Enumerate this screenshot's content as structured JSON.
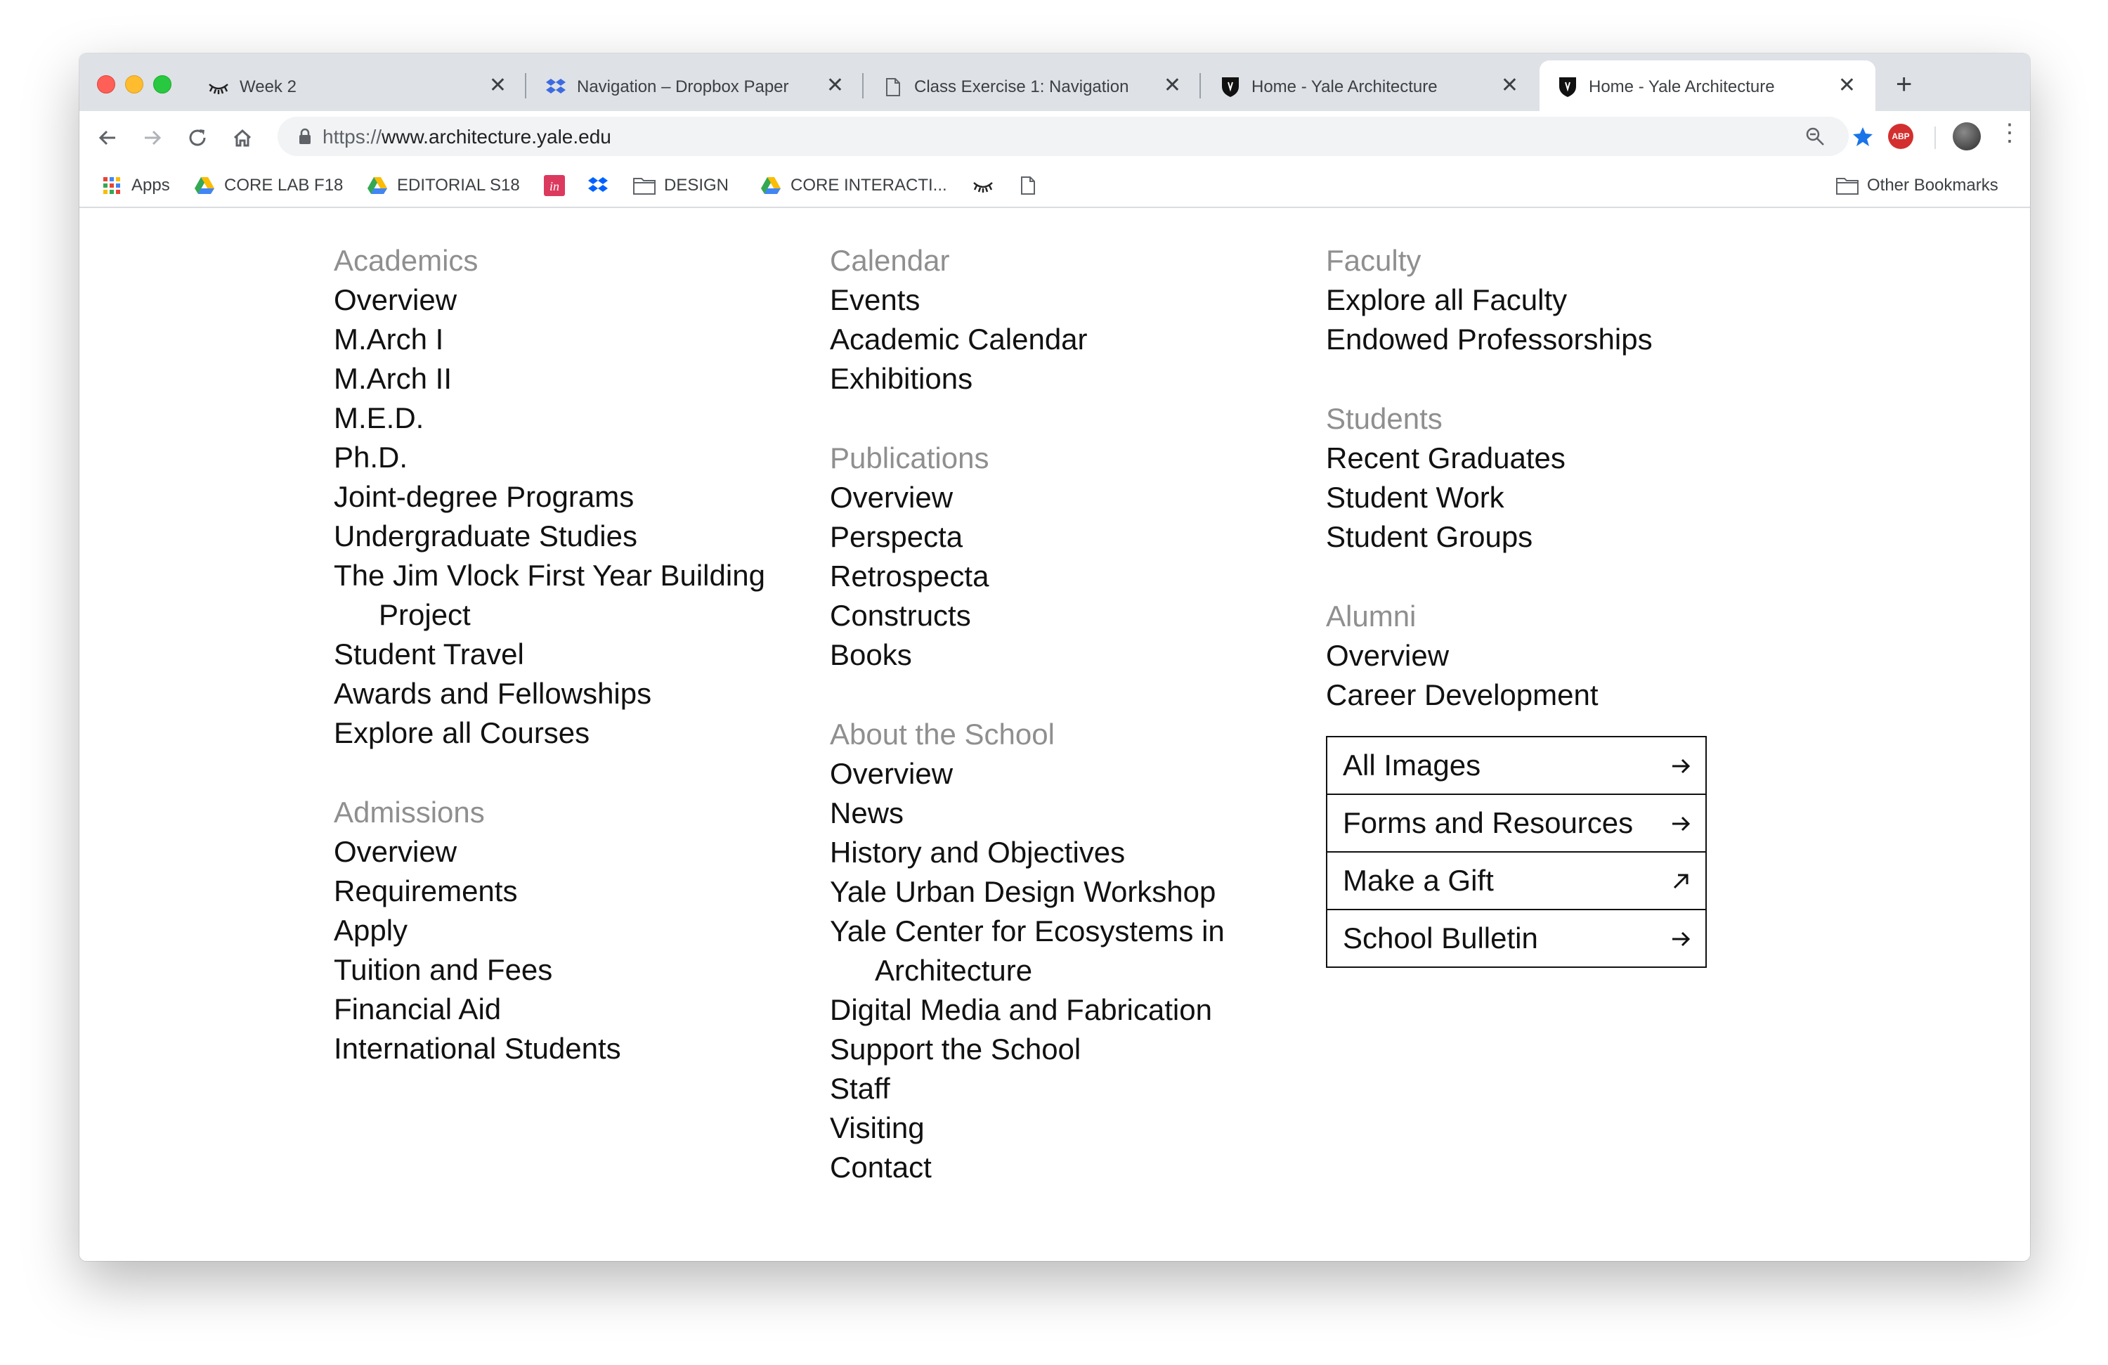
{
  "browser": {
    "tabs": [
      {
        "title": "Week 2",
        "favicon": "eyelash-icon",
        "active": false
      },
      {
        "title": "Navigation – Dropbox Paper",
        "favicon": "dropbox-icon",
        "active": false
      },
      {
        "title": "Class Exercise 1: Navigation",
        "favicon": "document-icon",
        "active": false
      },
      {
        "title": "Home - Yale Architecture",
        "favicon": "yale-shield-icon",
        "active": false
      },
      {
        "title": "Home - Yale Architecture",
        "favicon": "yale-shield-icon",
        "active": true
      }
    ],
    "address": {
      "scheme": "https://",
      "host": "www.architecture.yale.edu"
    },
    "bookmarks": [
      {
        "label": "Apps",
        "icon": "apps-grid-icon"
      },
      {
        "label": "CORE LAB F18",
        "icon": "google-drive-icon"
      },
      {
        "label": "EDITORIAL S18",
        "icon": "google-drive-icon"
      },
      {
        "label": "",
        "icon": "invision-icon"
      },
      {
        "label": "",
        "icon": "dropbox-icon"
      },
      {
        "label": "DESIGN",
        "icon": "folder-icon"
      },
      {
        "label": "CORE INTERACTI...",
        "icon": "google-drive-icon"
      },
      {
        "label": "",
        "icon": "eyelash-icon"
      },
      {
        "label": "",
        "icon": "document-icon"
      }
    ],
    "other_bookmarks": "Other Bookmarks"
  },
  "nav": {
    "academics": {
      "title": "Academics",
      "links": [
        "Overview",
        "M.Arch I",
        "M.Arch II",
        "M.E.D.",
        "Ph.D.",
        "Joint-degree Programs",
        "Undergraduate Studies"
      ],
      "jim_vlock_line1": "The Jim Vlock First Year Building",
      "jim_vlock_line2": "Project",
      "links_after": [
        "Student Travel",
        "Awards and Fellowships",
        "Explore all Courses"
      ]
    },
    "admissions": {
      "title": "Admissions",
      "links": [
        "Overview",
        "Requirements",
        "Apply",
        "Tuition and Fees",
        "Financial Aid",
        "International Students"
      ]
    },
    "calendar": {
      "title": "Calendar",
      "links": [
        "Events",
        "Academic Calendar",
        "Exhibitions"
      ]
    },
    "publications": {
      "title": "Publications",
      "links": [
        "Overview",
        "Perspecta",
        "Retrospecta",
        "Constructs",
        "Books"
      ]
    },
    "about": {
      "title": "About the School",
      "links": [
        "Overview",
        "News",
        "History and Objectives",
        "Yale Urban Design Workshop"
      ],
      "ecosystems_line1": "Yale Center for Ecosystems in",
      "ecosystems_line2": "Architecture",
      "links_after": [
        "Digital Media and Fabrication",
        "Support the School",
        "Staff",
        "Visiting",
        "Contact"
      ]
    },
    "faculty": {
      "title": "Faculty",
      "links": [
        "Explore all Faculty",
        "Endowed Professorships"
      ]
    },
    "students": {
      "title": "Students",
      "links": [
        "Recent Graduates",
        "Student Work",
        "Student Groups"
      ]
    },
    "alumni": {
      "title": "Alumni",
      "links": [
        "Overview",
        "Career Development"
      ]
    },
    "quick_links": [
      {
        "label": "All Images",
        "icon": "arrow-right-icon"
      },
      {
        "label": "Forms and Resources",
        "icon": "arrow-right-icon"
      },
      {
        "label": "Make a Gift",
        "icon": "arrow-up-right-icon"
      },
      {
        "label": "School Bulletin",
        "icon": "arrow-right-icon"
      }
    ]
  }
}
